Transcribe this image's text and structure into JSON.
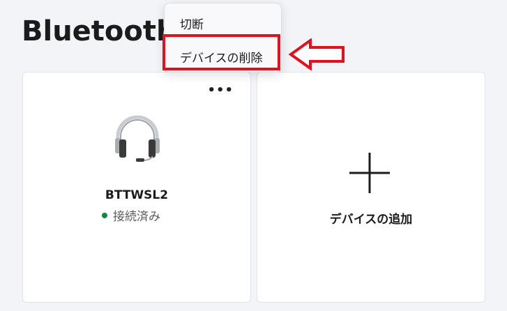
{
  "page": {
    "title": "Bluetooth"
  },
  "device_card": {
    "more_label": "•••",
    "icon": "headset-icon",
    "name": "BTTWSL2",
    "status": "接続済み",
    "status_color": "#10893e"
  },
  "add_card": {
    "icon": "plus-icon",
    "label": "デバイスの追加"
  },
  "context_menu": {
    "items": [
      {
        "label": "切断"
      },
      {
        "label": "デバイスの削除",
        "highlighted": true
      }
    ]
  },
  "annotation": {
    "highlight_color": "#e3101e",
    "arrow_icon": "left-arrow-icon"
  }
}
